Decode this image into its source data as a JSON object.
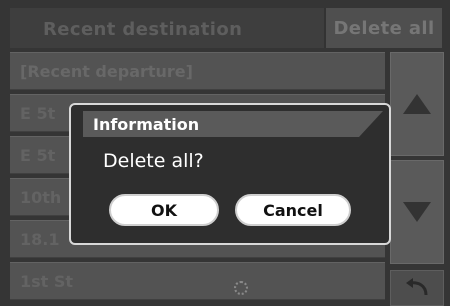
{
  "header": {
    "title": "Recent destination",
    "delete_all_label": "Delete all"
  },
  "list": {
    "items": [
      {
        "label": "[Recent departure]"
      },
      {
        "label": "E 5t"
      },
      {
        "label": "E 5t"
      },
      {
        "label": "10th"
      },
      {
        "label": "18.1"
      },
      {
        "label": "1st St"
      }
    ]
  },
  "scroll": {
    "up_icon": "triangle-up-icon",
    "down_icon": "triangle-down-icon",
    "back_icon": "back-arrow-icon"
  },
  "dialog": {
    "title": "Information",
    "message": "Delete all?",
    "ok_label": "OK",
    "cancel_label": "Cancel"
  }
}
